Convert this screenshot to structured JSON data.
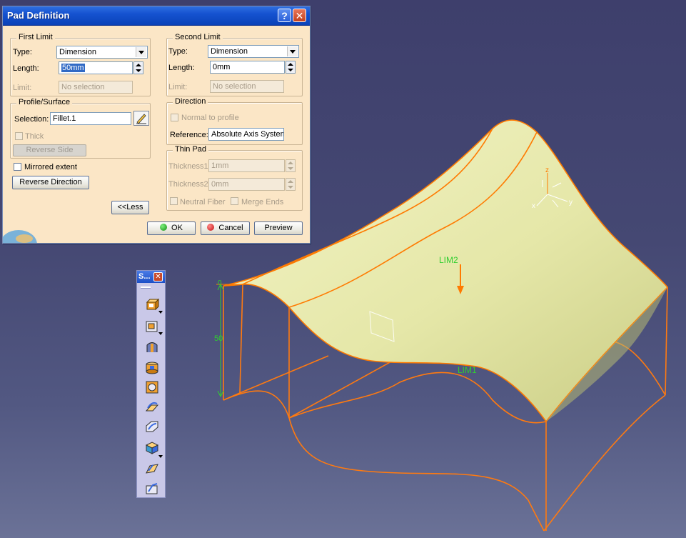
{
  "dialog": {
    "title": "Pad Definition",
    "help_label": "?",
    "close_label": "✕",
    "first_limit": {
      "legend": "First Limit",
      "type_label": "Type:",
      "type_value": "Dimension",
      "length_label": "Length:",
      "length_value": "50mm",
      "limit_label": "Limit:",
      "limit_value": "No selection"
    },
    "second_limit": {
      "legend": "Second Limit",
      "type_label": "Type:",
      "type_value": "Dimension",
      "length_label": "Length:",
      "length_value": "0mm",
      "limit_label": "Limit:",
      "limit_value": "No selection"
    },
    "profile": {
      "legend": "Profile/Surface",
      "selection_label": "Selection:",
      "selection_value": "Fillet.1",
      "thick_label": "Thick",
      "reverse_side_label": "Reverse Side"
    },
    "direction": {
      "legend": "Direction",
      "normal_label": "Normal to profile",
      "reference_label": "Reference:",
      "reference_value": "Absolute Axis System"
    },
    "thin_pad": {
      "legend": "Thin Pad",
      "thickness1_label": "Thickness1:",
      "thickness1_value": "1mm",
      "thickness2_label": "Thickness2:",
      "thickness2_value": "0mm",
      "neutral_label": "Neutral Fiber",
      "merge_label": "Merge Ends"
    },
    "mirrored_label": "Mirrored extent",
    "reverse_direction_label": "Reverse Direction",
    "less_label": "<<Less",
    "ok_label": "OK",
    "cancel_label": "Cancel",
    "preview_label": "Preview"
  },
  "toolbar": {
    "title": "S...",
    "close_label": "✕",
    "icons": [
      "pad-icon",
      "pocket-icon",
      "shaft-icon",
      "groove-icon",
      "hole-icon",
      "rib-icon",
      "slot-icon",
      "stiffener-icon",
      "multi-sections-solid-icon",
      "removed-multi-sections-solid-icon"
    ]
  },
  "viewport": {
    "lim2_label": "LIM2",
    "lim1_label": "LIM1",
    "dim_value": "50",
    "dim_zero": "0",
    "axis_z": "z",
    "axis_y": "y",
    "axis_x": "x",
    "colors": {
      "surface": "#e8eab0",
      "edges": "#ff7a00",
      "labels": "#2fcf2f"
    }
  }
}
